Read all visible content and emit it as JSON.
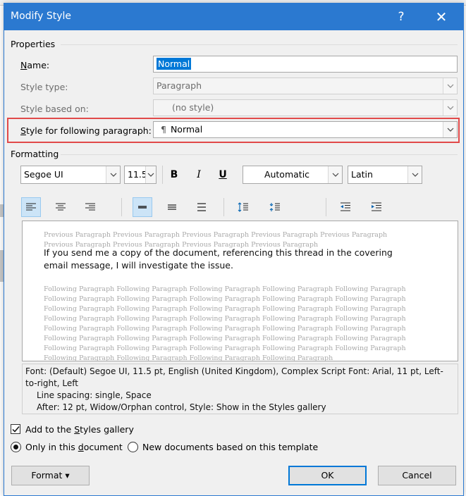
{
  "dialog": {
    "title": "Modify Style",
    "help_label": "?",
    "close_label": "✕"
  },
  "properties": {
    "section_label": "Properties",
    "name": {
      "label_u": "N",
      "label_rest": "ame:",
      "value": "Normal"
    },
    "style_type": {
      "label": "Style type:",
      "value": "Paragraph"
    },
    "style_based_on": {
      "label": "Style based on:",
      "value": "(no style)"
    },
    "style_following": {
      "label_u": "S",
      "label_rest": "tyle for following paragraph:",
      "mark": "¶",
      "value": "Normal"
    }
  },
  "formatting": {
    "section_label": "Formatting",
    "font": "Segoe UI",
    "size": "11.5",
    "bold": "B",
    "italic": "I",
    "underline": "U",
    "color": "Automatic",
    "language": "Latin"
  },
  "preview": {
    "previous": "Previous Paragraph Previous Paragraph Previous Paragraph Previous Paragraph Previous Paragraph Previous Paragraph Previous Paragraph Previous Paragraph Previous Paragraph",
    "sample": "If you send me a copy of the document, referencing this thread in the covering email message, I will investigate the issue.",
    "following_lines": [
      "Following Paragraph Following Paragraph Following Paragraph Following Paragraph Following Paragraph",
      "Following Paragraph Following Paragraph Following Paragraph Following Paragraph Following Paragraph",
      "Following Paragraph Following Paragraph Following Paragraph Following Paragraph Following Paragraph",
      "Following Paragraph Following Paragraph Following Paragraph Following Paragraph Following Paragraph",
      "Following Paragraph Following Paragraph Following Paragraph Following Paragraph Following Paragraph",
      "Following Paragraph Following Paragraph Following Paragraph Following Paragraph Following Paragraph",
      "Following Paragraph Following Paragraph Following Paragraph Following Paragraph Following Paragraph",
      "Following Paragraph Following Paragraph Following Paragraph Following Paragraph"
    ]
  },
  "description": {
    "line1": "Font: (Default) Segoe UI, 11.5 pt, English (United Kingdom), Complex Script Font: Arial, 11 pt, Left-to-right, Left",
    "line2": "Line spacing:  single, Space",
    "line3": "After:  12 pt, Widow/Orphan control, Style: Show in the Styles gallery"
  },
  "options": {
    "add_to_gallery": {
      "label_pre": "Add to the ",
      "label_u": "S",
      "label_post": "tyles gallery",
      "checked": true
    },
    "only_this_doc": {
      "label_pre": "Only in this ",
      "label_u": "d",
      "label_post": "ocument",
      "selected": true
    },
    "new_docs": {
      "label": "New documents based on this template",
      "selected": false
    }
  },
  "buttons": {
    "format": "Format",
    "format_arrow": "▾",
    "ok": "OK",
    "cancel": "Cancel"
  },
  "colors": {
    "title_bar": "#2b79d0",
    "highlight_box": "#e14a4a",
    "selection": "#0078d7"
  }
}
